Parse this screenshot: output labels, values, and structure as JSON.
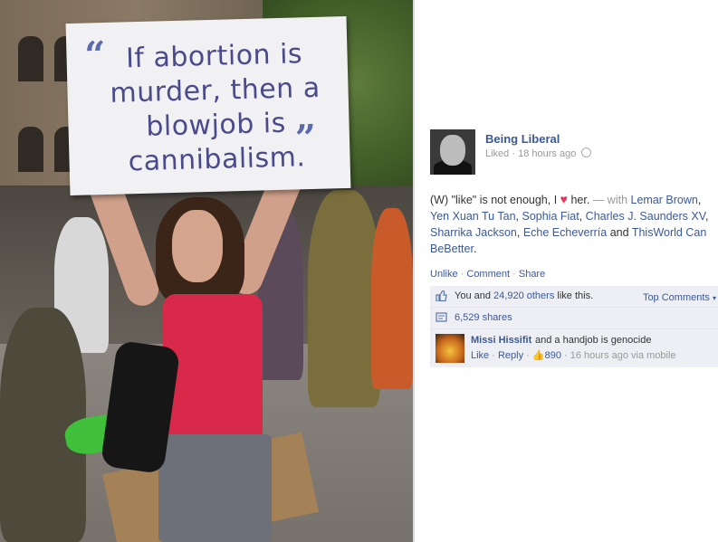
{
  "photo": {
    "sign": {
      "quote_open": "“",
      "text": "If abortion is murder, then a blowjob is cannibalism.",
      "quote_close": "”"
    },
    "colors": {
      "sign_ink": "#4a4a8c",
      "tank_top": "#d8294a"
    }
  },
  "post": {
    "page_name": "Being Liberal",
    "meta_liked": "Liked",
    "meta_sep": "·",
    "meta_time": "18 hours ago",
    "text_before": "(W) \"like\" is not enough, I",
    "heart_icon": "heart-icon",
    "text_after": "her.",
    "with_label": "— with",
    "tagged": [
      "Lemar Brown",
      "Yen Xuan Tu Tan",
      "Sophia Fiat",
      "Charles J. Saunders XV",
      "Sharrika Jackson",
      "Eche Echeverría"
    ],
    "and_label": "and",
    "tagged_last": "ThisWorld Can BeBetter",
    "period": ".",
    "actions": {
      "unlike": "Unlike",
      "comment": "Comment",
      "share": "Share"
    }
  },
  "feedback": {
    "likes_prefix": "You and",
    "likes_count": "24,920 others",
    "likes_suffix": "like this.",
    "top_comments": "Top Comments",
    "shares": "6,529 shares"
  },
  "comment": {
    "author": "Missi Hissifit",
    "body": "and a handjob is genocide",
    "like": "Like",
    "reply": "Reply",
    "like_count": "890",
    "time": "16 hours ago via mobile"
  },
  "colors": {
    "fb_link": "#3b5998",
    "fb_muted": "#999999",
    "fb_box": "#edeff4"
  }
}
